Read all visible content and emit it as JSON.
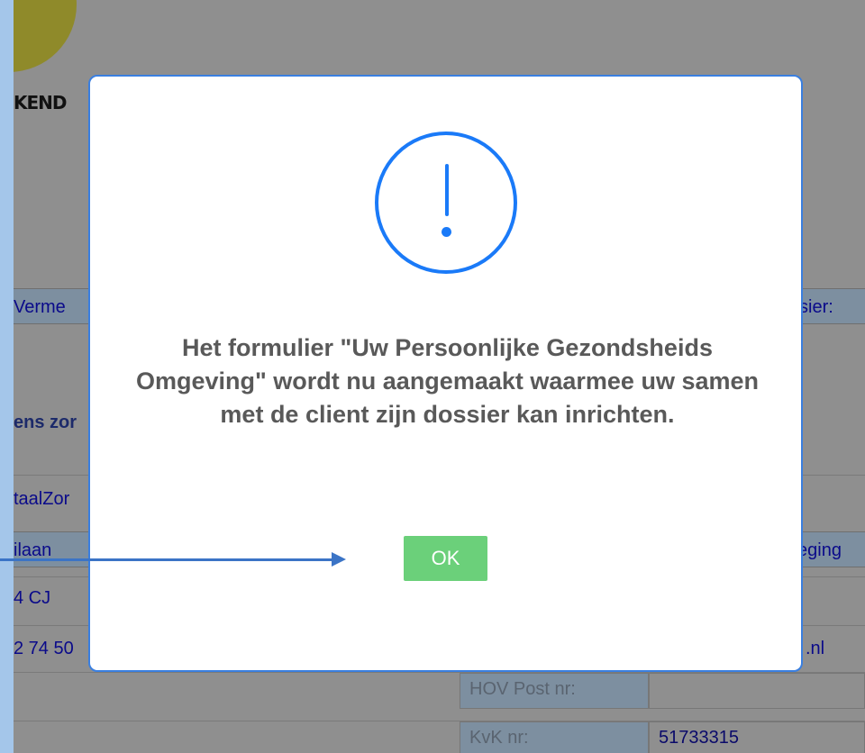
{
  "background": {
    "brand_text": "KEND",
    "left_column": {
      "vermelding": "Verme",
      "section_heading": "ens zor",
      "org_name": "taalZor",
      "street": "ilaan",
      "postcode": "4 CJ",
      "phone": "2 74 50"
    },
    "right_column": {
      "dossier": "ssier:",
      "omgeving": "eging",
      "email_tail": ".nl"
    },
    "table": {
      "hov_label": "HOV Post nr:",
      "hov_value": "",
      "kvk_label": "KvK nr:",
      "kvk_value": "51733315"
    }
  },
  "modal": {
    "icon": "exclamation-icon",
    "message": "Het formulier \"Uw Persoonlijke Gezondsheids Omgeving\" wordt nu aangemaakt waarmee uw samen met de client zijn dossier kan inrichten.",
    "ok_label": "OK"
  },
  "annotation": {
    "icon": "arrow-right-icon",
    "color": "#3b74c6"
  },
  "colors": {
    "accent": "#1a7af8",
    "ok_button": "#6bd07a",
    "overlay": "#8f8f8f"
  }
}
